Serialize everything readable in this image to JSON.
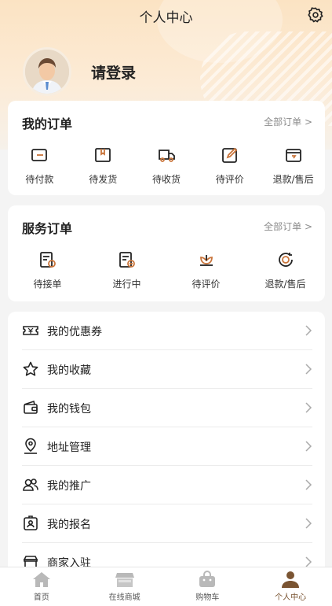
{
  "header": {
    "title": "个人中心",
    "settings_icon": "gear-icon",
    "login_text": "请登录"
  },
  "my_orders": {
    "title": "我的订单",
    "more": "全部订单 >",
    "items": [
      {
        "label": "待付款",
        "icon": "wallet-card-icon"
      },
      {
        "label": "待发货",
        "icon": "package-box-icon"
      },
      {
        "label": "待收货",
        "icon": "delivery-truck-icon"
      },
      {
        "label": "待评价",
        "icon": "edit-review-icon"
      },
      {
        "label": "退款/售后",
        "icon": "refund-box-icon"
      }
    ]
  },
  "service_orders": {
    "title": "服务订单",
    "more": "全部订单 >",
    "items": [
      {
        "label": "待接单",
        "icon": "pending-order-icon"
      },
      {
        "label": "进行中",
        "icon": "in-progress-icon"
      },
      {
        "label": "待评价",
        "icon": "flower-review-icon"
      },
      {
        "label": "退款/售后",
        "icon": "refund-coin-icon"
      }
    ]
  },
  "menu": [
    {
      "label": "我的优惠券",
      "icon": "coupon-icon"
    },
    {
      "label": "我的收藏",
      "icon": "star-icon"
    },
    {
      "label": "我的钱包",
      "icon": "wallet-icon"
    },
    {
      "label": "地址管理",
      "icon": "location-icon"
    },
    {
      "label": "我的推广",
      "icon": "users-icon"
    },
    {
      "label": "我的报名",
      "icon": "id-badge-icon"
    },
    {
      "label": "商家入驻",
      "icon": "store-icon"
    }
  ],
  "tabbar": [
    {
      "label": "首页",
      "icon": "home-icon"
    },
    {
      "label": "在线商城",
      "icon": "shop-icon"
    },
    {
      "label": "购物车",
      "icon": "bag-icon"
    },
    {
      "label": "个人中心",
      "icon": "person-icon",
      "active": true
    }
  ],
  "colors": {
    "accent": "#7a5432",
    "hero_top": "#fbe3c3",
    "background": "#f4f4f4"
  }
}
